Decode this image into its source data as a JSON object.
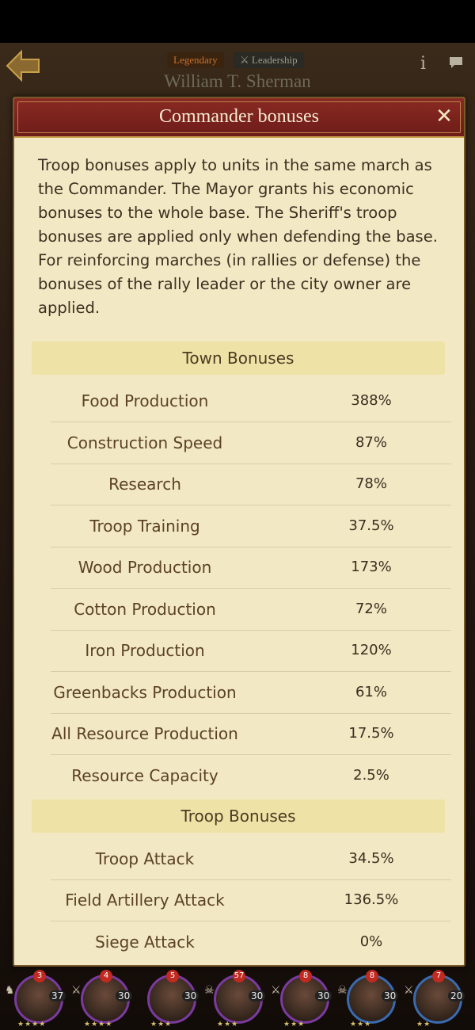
{
  "top": {
    "tag_rarity": "Legendary",
    "tag_type": "Leadership",
    "commander_name": "William T. Sherman",
    "info_icon": "i"
  },
  "modal": {
    "title": "Commander bonuses",
    "close_icon": "✕",
    "description": "Troop bonuses apply to units in the same march as the Commander. The Mayor grants his economic bonuses to the whole base. The Sheriff's troop bonuses are applied only when defending the base. For reinforcing marches (in rallies or defense) the bonuses of the rally leader or the city owner are applied.",
    "town_header": "Town Bonuses",
    "town_rows": [
      {
        "label": "Food Production",
        "value": "388%"
      },
      {
        "label": "Construction Speed",
        "value": "87%"
      },
      {
        "label": "Research",
        "value": "78%"
      },
      {
        "label": "Troop Training",
        "value": "37.5%"
      },
      {
        "label": "Wood Production",
        "value": "173%"
      },
      {
        "label": "Cotton Production",
        "value": "72%"
      },
      {
        "label": "Iron Production",
        "value": "120%"
      },
      {
        "label": "Greenbacks Production",
        "value": "61%"
      },
      {
        "label": "All Resource Production",
        "value": "17.5%"
      },
      {
        "label": "Resource Capacity",
        "value": "2.5%"
      }
    ],
    "troop_header": "Troop Bonuses",
    "troop_rows": [
      {
        "label": "Troop Attack",
        "value": "34.5%"
      },
      {
        "label": "Field Artillery Attack",
        "value": "136.5%"
      },
      {
        "label": "Siege Attack",
        "value": "0%"
      }
    ]
  },
  "portraits": [
    {
      "badge": "3",
      "level": "37",
      "stars": "★★★★"
    },
    {
      "badge": "4",
      "level": "30",
      "stars": "★★★★"
    },
    {
      "badge": "5",
      "level": "30",
      "stars": "★★★"
    },
    {
      "badge": "57",
      "level": "30",
      "stars": "★★★"
    },
    {
      "badge": "8",
      "level": "30",
      "stars": "★★★"
    },
    {
      "badge": "8",
      "level": "30",
      "stars": "★★★"
    },
    {
      "badge": "7",
      "level": "20",
      "stars": "★★"
    }
  ]
}
